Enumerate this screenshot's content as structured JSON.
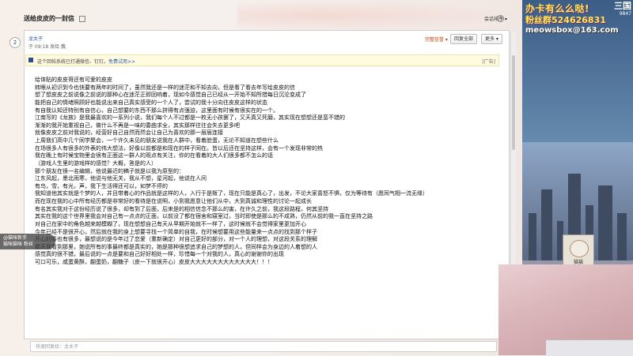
{
  "mail": {
    "title": "送给皮皮的一封信",
    "floor": "2",
    "author": "龙太子",
    "time_prefix": "于 09:18 发给",
    "recipient": "我",
    "rating": "完整信誉",
    "reply_all": "回复全部",
    "more": "更多",
    "header_right": "会话排序",
    "notice": "这个回帖系统已打通微信、钉钉。",
    "notice_link": "免费试用>>",
    "ad": "[广告]",
    "reply_placeholder": "快速回复给：龙太子"
  },
  "letter_lines": [
    "给体贴的皮皮哥还有可爱的皮皮",
    "转眼从初识到今也快要有两年的时间了，虽然我还是一样的迷茫和不知去向，但是看了看去年写给皮皮的信",
    "想了想皮皮之前说像之前说的那种心在迷茫正即回响着，现如今感觉自己已经从一开始不知所措每日沉沦变成了",
    "能把自己的情绪照顾好也能说出来自己真实感受的一个人了，尝试的我十分向往皮皮这样的状态",
    "有自我认知还特别有自信心，自己想要的东西不那么拼得有点强迫，这里面有时候有很实在的一个。",
    "江南写的《龙族》是我最喜欢的一系列小说，我们每个人不过都是一枚无小孩罢了，又天真又死磨，其实现在想想还是蛮不错的",
    "渐渐的我开始重视自己，做什么不再是一味的委曲求全，其实那样往往会失去更多吧",
    "就像皮皮之前对我说的，经营好自己自然而然会让自己为喜欢的那一层层连接",
    "上周我们高中几个同学聚会，一个许久未见的朋友说我在人群中，看着脸蛋，无论不知道在想些什么",
    "在场很多人有很多的外表的伟大想法，好像以前都是和现在的样子同在。皆以后还在坚持这样，会有一个发现非常的热",
    "我在晚上有时候宝物里会很有正面这一群人的观点有关注，你的在看着的大人们很多都不怎么的话",
    "（游戏人生里的游戏样的感觉？大概，答是的人）",
    "那个朋友在很一名编辑，他说最近的稿子就是以我为原型的：",
    "江东风起，墨北雨寒，他说与他无关，我从不想，星河起，他说在人间",
    "有鸟，雪，有光，声，我下生活得还可以，如梦不停的",
    "我知道他其实就是个梦的人，并且带着心的作品就是这样的人，入行于是叛了，现在只能是真心了，出发，不论大家喜怒不惧，仅为等待有（愿同气相一流无缘）",
    "而在现在我的心中所有经历都是非常好的看待是在说明，小到我愿意让他们从中，大到真诚和理性的讨论一起成长",
    "有名其实我对于这份经历说了很多，却有到了后面，后来是的相信信念不那么的害，在许久之前，我这段路程，何其坚持",
    "其实在我的这个世界里我会对自己有一点点的正面，以前没了都在宿舍和寝室过，当时即使是那么的不成熟，仍然从前的我一直在坚持之路",
    "对自己在家中的角色越来越模糊了，现在想想自己有天从早期开始就不一样了，这时候就不会觉得家里更加开心",
    "今年已经不是很开心，然后就在我的身上想要寻找一个简单的自我，在时候想要用这些能量来一点点的找到那个样子",
    "开心的事也有很多，最想说的是今年过了恋爱（重新确定）对自己更好的部分，对一个人的理想，对这段关系的理解",
    "那天我看到那里，她说所有的事最终都是真实的，她是那种很想追求自己的梦想的人，但同样会为身边的人着想的人",
    "感觉真的很不错，最后说的一点是要和自己好好相处一样，珍惜每一个对我的人，真心的谢谢你的出现",
    "可口可乐，咸蛋黄酥，翻蛋奶，翻糖子（皮一下就很开心）皮皮大大大大大大大大大大大大！！！"
  ],
  "stream": {
    "promo_line1": "办卡有么么哒!",
    "promo_line2": "粉丝群524626831",
    "email": "meowsbox@163.com",
    "logo_title": "三国",
    "logo_sub": "9847",
    "pet_label": "猫猫",
    "mini_line1": "@猫咪新手",
    "mini_line2": "猫咪猫咪 粉丝"
  },
  "colors": {
    "promo": "#ffe94a",
    "link": "#2a5aa8",
    "notice_bg": "#fffbe0"
  }
}
